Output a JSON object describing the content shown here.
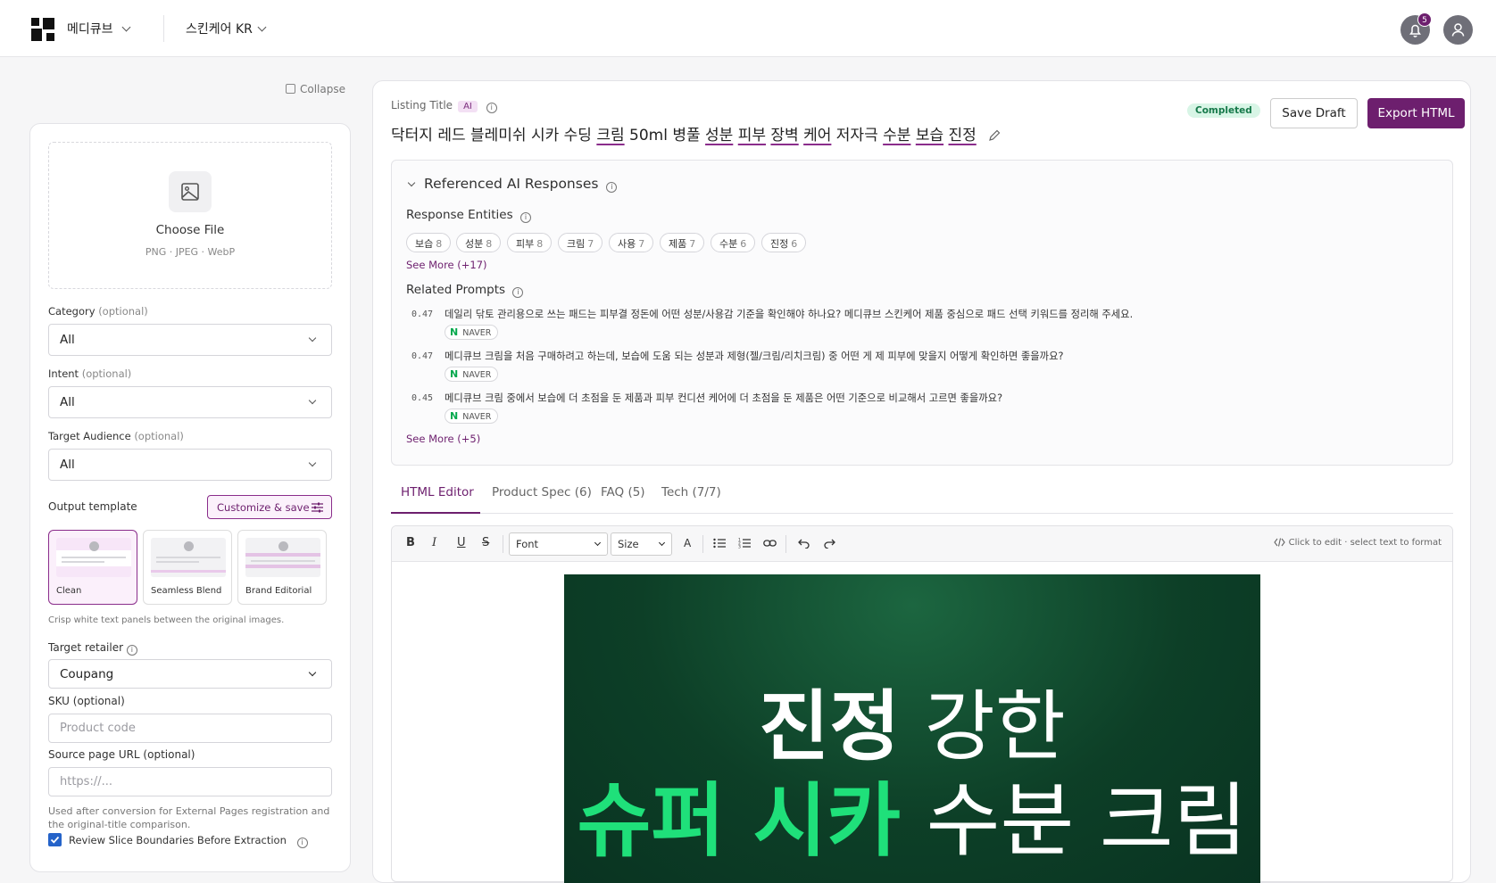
{
  "topbar": {
    "brand": "메디큐브",
    "workspace": "스킨케어 KR",
    "notification_count": "5",
    "icons": [
      "bell-icon",
      "user-icon"
    ]
  },
  "sidebar": {
    "collapse_label": "Collapse",
    "upload": {
      "title": "Choose File",
      "formats": "PNG · JPEG · WebP"
    },
    "category": {
      "label": "Category",
      "optional": "(optional)",
      "value": "All"
    },
    "intent": {
      "label": "Intent",
      "optional": "(optional)",
      "value": "All"
    },
    "audience": {
      "label": "Target Audience",
      "optional": "(optional)",
      "value": "All"
    },
    "output_template": {
      "label": "Output template",
      "customize_label": "Customize & save",
      "options": [
        "Clean",
        "Seamless Blend",
        "Brand Editorial"
      ],
      "selected": "Clean",
      "hint": "Crisp white text panels between the original images."
    },
    "retailer": {
      "label": "Target retailer",
      "value": "Coupang"
    },
    "sku": {
      "label": "SKU (optional)",
      "placeholder": "Product code"
    },
    "source_url": {
      "label": "Source page URL (optional)",
      "placeholder": "https://...",
      "hint_line1": "Used after conversion for External Pages registration and",
      "hint_line2": "the original-title comparison."
    },
    "review_slices": {
      "label": "Review Slice Boundaries Before Extraction",
      "checked": true
    }
  },
  "listing": {
    "label": "Listing Title",
    "ai_tag": "AI",
    "title_parts": [
      "닥터지 레드 블레미쉬 시카 수딩 ",
      "크림",
      " 50ml 병풀 ",
      "성분",
      " ",
      "피부",
      " ",
      "장벽",
      " ",
      "케어",
      " 저자극 ",
      "수분",
      " ",
      "보습",
      " ",
      "진정"
    ],
    "status": "Completed",
    "save_draft": "Save Draft",
    "export": "Export HTML"
  },
  "referenced": {
    "heading": "Referenced AI Responses",
    "entities_label": "Response Entities",
    "entities": [
      {
        "name": "보습",
        "count": "8"
      },
      {
        "name": "성분",
        "count": "8"
      },
      {
        "name": "피부",
        "count": "8"
      },
      {
        "name": "크림",
        "count": "7"
      },
      {
        "name": "사용",
        "count": "7"
      },
      {
        "name": "제품",
        "count": "7"
      },
      {
        "name": "수분",
        "count": "6"
      },
      {
        "name": "진정",
        "count": "6"
      }
    ],
    "entities_more": "See More (+17)",
    "prompts_label": "Related Prompts",
    "prompts": [
      {
        "score": "0.47",
        "text": "데일리 닦토 관리용으로 쓰는 패드는 피부결 정돈에 어떤 성분/사용감 기준을 확인해야 하나요? 메디큐브 스킨케어 제품 중심으로 패드 선택 키워드를 정리해 주세요.",
        "source": "NAVER"
      },
      {
        "score": "0.47",
        "text": "메디큐브 크림을 처음 구매하려고 하는데, 보습에 도움 되는 성분과 제형(젤/크림/리치크림) 중 어떤 게 제 피부에 맞을지 어떻게 확인하면 좋을까요?",
        "source": "NAVER"
      },
      {
        "score": "0.45",
        "text": "메디큐브 크림 중에서 보습에 더 초점을 둔 제품과 피부 컨디션 케어에 더 초점을 둔 제품은 어떤 기준으로 비교해서 고르면 좋을까요?",
        "source": "NAVER"
      }
    ],
    "prompts_more": "See More (+5)"
  },
  "tabs": [
    {
      "label": "HTML Editor",
      "active": true
    },
    {
      "label": "Product Spec (6)",
      "active": false
    },
    {
      "label": "FAQ (5)",
      "active": false
    },
    {
      "label": "Tech (7/7)",
      "active": false
    }
  ],
  "editor": {
    "toolbar": {
      "font": "Font",
      "size": "Size",
      "text_color": "A",
      "hint": "Click to edit · select text to format"
    },
    "hero": {
      "line1_bold": "진정",
      "line1_rest": " 강한",
      "line2_green": "슈퍼 시카",
      "line2_rest": " 수분 크림"
    }
  },
  "colors": {
    "accent": "#6d1f6e",
    "completed_bg": "#d8f5e6",
    "completed_text": "#16794a",
    "hero_green": "#1fe07a",
    "naver_green": "#03a94d"
  }
}
